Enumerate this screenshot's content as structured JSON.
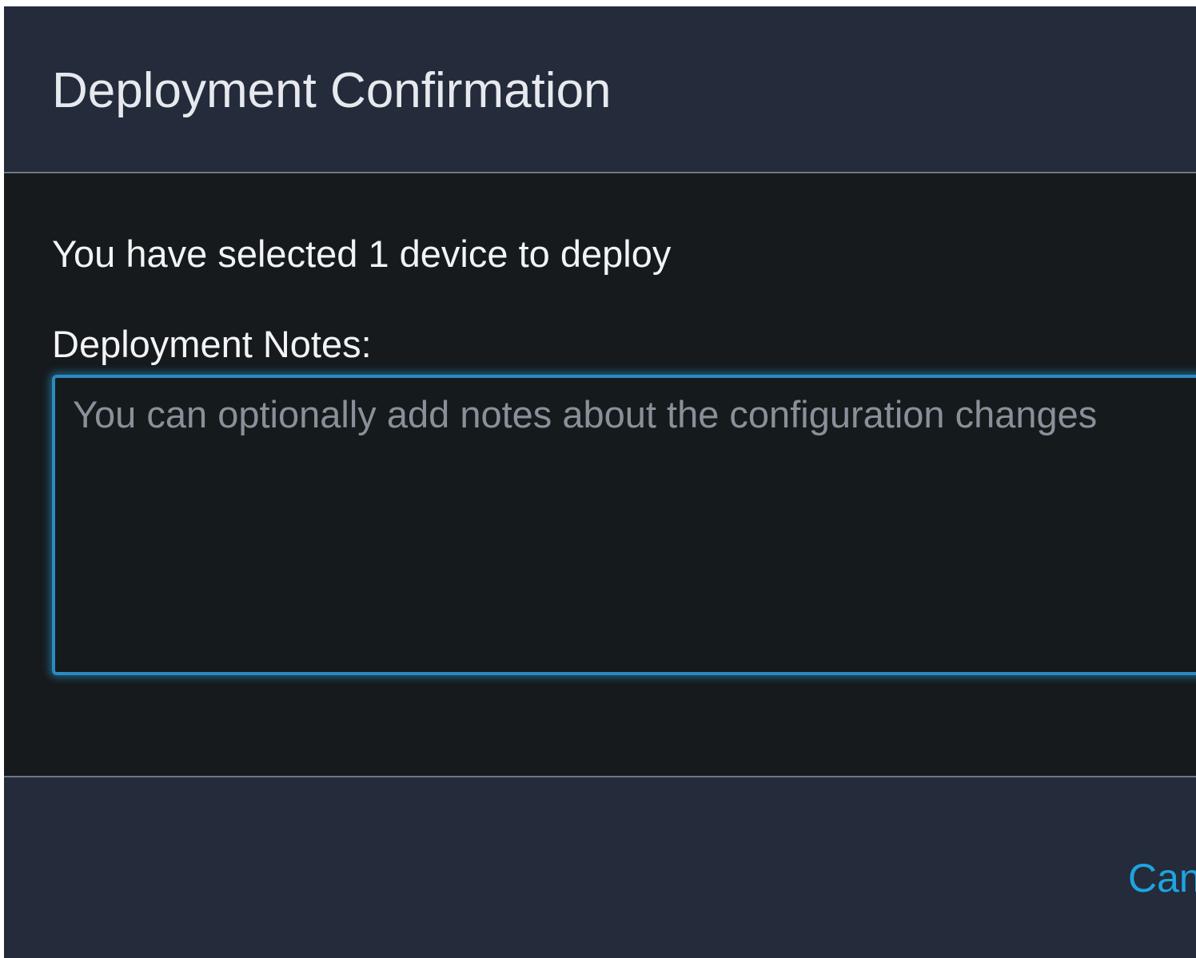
{
  "modal": {
    "title": "Deployment Confirmation"
  },
  "body": {
    "selection_text": "You have selected 1 device to deploy",
    "notes_label": "Deployment Notes:",
    "notes_value": "",
    "notes_placeholder": "You can optionally add notes about the configuration changes"
  },
  "footer": {
    "cancel_label": "Cancel"
  },
  "colors": {
    "header_bg": "#242c3b",
    "body_bg": "#161a1d",
    "accent": "#1fa3e0",
    "focus_border": "#2a8bc0"
  }
}
